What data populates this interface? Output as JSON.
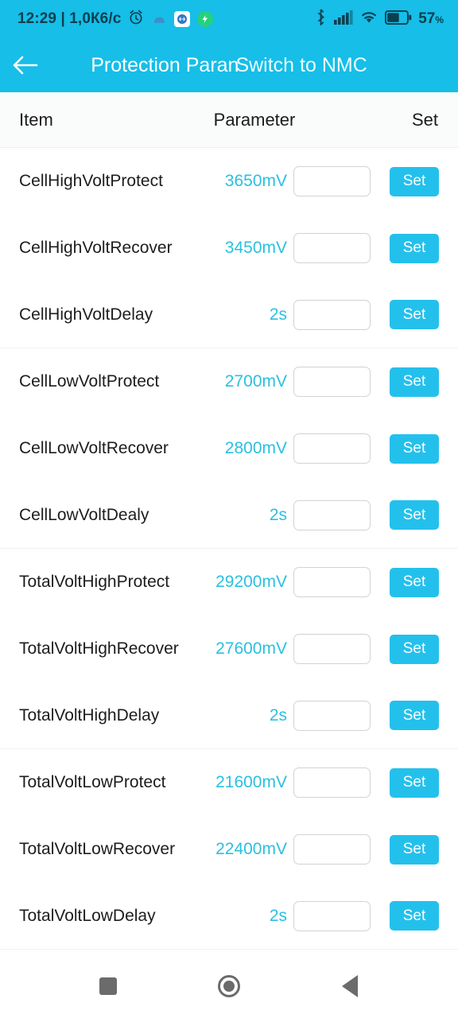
{
  "statusbar": {
    "clock": "12:29 | 1,0К6/c",
    "battery_percent": "57",
    "percent_symbol": "%",
    "icons": [
      "alarm-clock-icon",
      "app-notification-icon",
      "messenger-notification-icon",
      "charging-bolt-icon",
      "bluetooth-icon",
      "cellular-signal-icon",
      "wifi-icon",
      "battery-icon"
    ],
    "accent": "#16bee8"
  },
  "appbar": {
    "back_label": "back-arrow",
    "title": "Protection Paran",
    "title_overlay": "Switch to NMC",
    "background": "#16bee8"
  },
  "table": {
    "headers": {
      "item": "Item",
      "parameter": "Parameter",
      "set": "Set"
    },
    "set_button_label": "Set",
    "input_placeholder": "",
    "value_color": "#2ac0e0",
    "button_color": "#24c0ec",
    "rows": [
      {
        "item": "CellHighVoltProtect",
        "value": "3650mV",
        "input": "",
        "group_end": false
      },
      {
        "item": "CellHighVoltRecover",
        "value": "3450mV",
        "input": "",
        "group_end": false
      },
      {
        "item": "CellHighVoltDelay",
        "value": "2s",
        "input": "",
        "group_end": true
      },
      {
        "item": "CellLowVoltProtect",
        "value": "2700mV",
        "input": "",
        "group_end": false
      },
      {
        "item": "CellLowVoltRecover",
        "value": "2800mV",
        "input": "",
        "group_end": false
      },
      {
        "item": "CellLowVoltDealy",
        "value": "2s",
        "input": "",
        "group_end": true
      },
      {
        "item": "TotalVoltHighProtect",
        "value": "29200mV",
        "input": "",
        "group_end": false
      },
      {
        "item": "TotalVoltHighRecover",
        "value": "27600mV",
        "input": "",
        "group_end": false
      },
      {
        "item": "TotalVoltHighDelay",
        "value": "2s",
        "input": "",
        "group_end": true
      },
      {
        "item": "TotalVoltLowProtect",
        "value": "21600mV",
        "input": "",
        "group_end": false
      },
      {
        "item": "TotalVoltLowRecover",
        "value": "22400mV",
        "input": "",
        "group_end": false
      },
      {
        "item": "TotalVoltLowDelay",
        "value": "2s",
        "input": "",
        "group_end": true
      }
    ]
  },
  "navbar": {
    "recents": "recents-square-icon",
    "home": "home-circle-icon",
    "back": "back-triangle-icon"
  }
}
